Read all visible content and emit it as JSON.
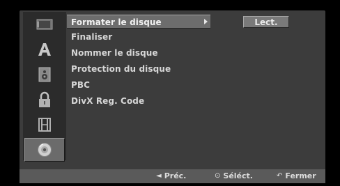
{
  "menu": {
    "items": [
      {
        "label": "Formater le disque"
      },
      {
        "label": "Finaliser"
      },
      {
        "label": "Nommer le disque"
      },
      {
        "label": "Protection du disque"
      },
      {
        "label": "PBC"
      },
      {
        "label": "DivX  Reg. Code"
      }
    ]
  },
  "option": {
    "value": "Lect."
  },
  "footer": {
    "prev_label": "Préc.",
    "select_label": "Séléct.",
    "close_label": "Fermer",
    "prev_glyph": "◄",
    "select_glyph": "⊙",
    "close_glyph": "↶"
  },
  "icons": {
    "sidebar": [
      "screen-icon",
      "letter-a-icon",
      "speaker-icon",
      "lock-icon",
      "film-icon",
      "disc-icon"
    ]
  }
}
